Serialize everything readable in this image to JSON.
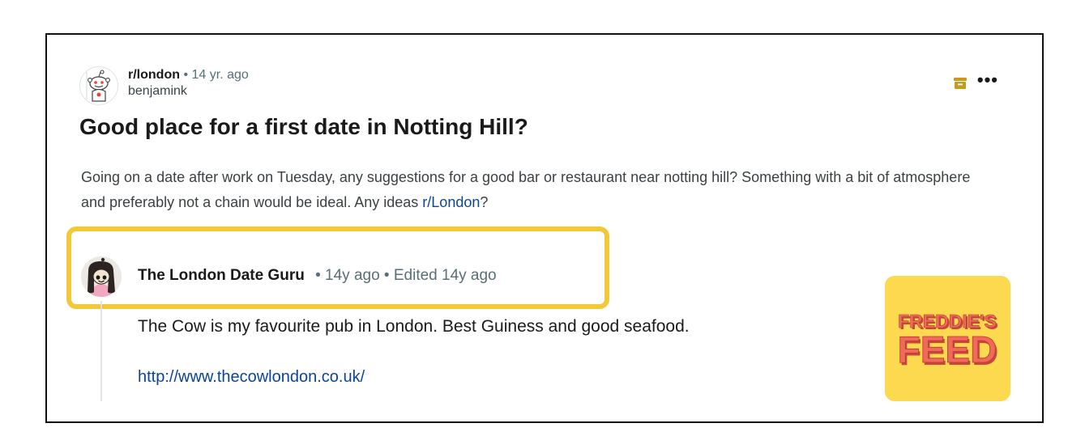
{
  "post": {
    "subreddit": "r/london",
    "separator": "•",
    "time": "14 yr. ago",
    "author": "benjamink",
    "title": "Good place for a first date in Notting Hill?",
    "body_text": "Going on a date after work on Tuesday, any suggestions for a good bar or restaurant near notting hill? Something with a bit of atmosphere and preferably not a chain would be ideal. Any ideas ",
    "body_link": "r/London",
    "body_end": "?"
  },
  "actions": {
    "archive_icon": "archive-icon",
    "more_label": "•••"
  },
  "comment": {
    "author": "The London Date Guru",
    "meta": "• 14y ago • Edited 14y ago",
    "text": "The Cow is my favourite pub in London. Best Guiness and good seafood.",
    "link": "http://www.thecowlondon.co.uk/"
  },
  "logo": {
    "line1": "FREDDIE'S",
    "line2": "FEED"
  },
  "colors": {
    "highlight": "#f0c839",
    "link": "#0a449b",
    "logo_bg": "#fcd94e",
    "logo_text": "#ef6a5b",
    "archive": "#c99a1e"
  }
}
